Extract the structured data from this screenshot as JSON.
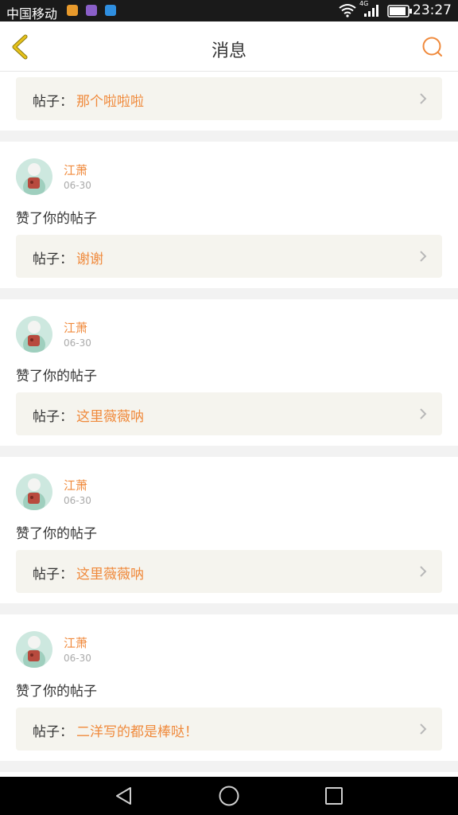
{
  "status_bar": {
    "carrier": "中国移动",
    "network": "4G",
    "time": "23:27"
  },
  "header": {
    "title": "消息"
  },
  "colors": {
    "accent": "#f08a3c",
    "post_box_bg": "#f5f4ee",
    "page_bg": "#f2f2f2"
  },
  "feed": {
    "first": {
      "post_label": "帖子：",
      "post_title": "那个啦啦啦"
    },
    "items": [
      {
        "username": "江萧",
        "date": "06-30",
        "action": "赞了你的帖子",
        "post_label": "帖子：",
        "post_title": "谢谢"
      },
      {
        "username": "江萧",
        "date": "06-30",
        "action": "赞了你的帖子",
        "post_label": "帖子：",
        "post_title": "这里薇薇呐"
      },
      {
        "username": "江萧",
        "date": "06-30",
        "action": "赞了你的帖子",
        "post_label": "帖子：",
        "post_title": "这里薇薇呐"
      },
      {
        "username": "江萧",
        "date": "06-30",
        "action": "赞了你的帖子",
        "post_label": "帖子：",
        "post_title": "二洋写的都是棒哒！"
      }
    ]
  },
  "icons": {
    "back": "chevron-left-icon",
    "search": "search-icon",
    "nav_back": "triangle-back-icon",
    "nav_home": "circle-home-icon",
    "nav_recent": "square-recent-icon"
  }
}
